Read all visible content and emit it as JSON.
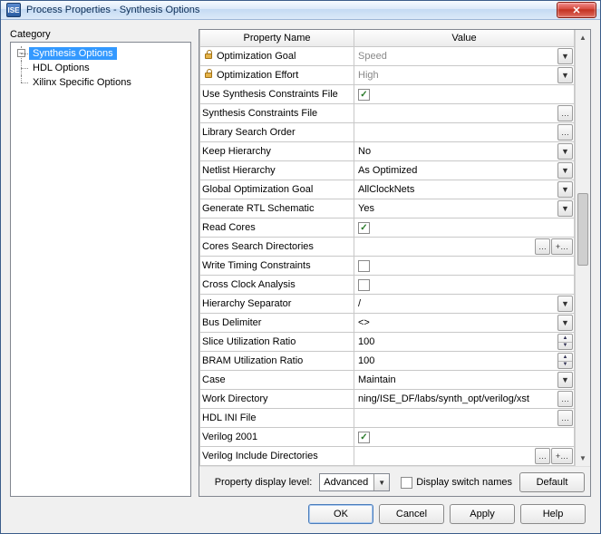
{
  "window": {
    "title": "Process Properties - Synthesis Options",
    "app_icon_text": "ISE"
  },
  "category": {
    "label": "Category",
    "items": [
      {
        "label": "Synthesis Options",
        "selected": true
      },
      {
        "label": "HDL Options",
        "selected": false
      },
      {
        "label": "Xilinx Specific Options",
        "selected": false
      }
    ]
  },
  "grid": {
    "headers": {
      "name": "Property Name",
      "value": "Value"
    },
    "rows": [
      {
        "name": "Optimization Goal",
        "locked": true,
        "type": "dropdown",
        "value": "Speed",
        "disabled": true
      },
      {
        "name": "Optimization Effort",
        "locked": true,
        "type": "dropdown",
        "value": "High",
        "disabled": true
      },
      {
        "name": "Use Synthesis Constraints File",
        "type": "checkbox",
        "value": true
      },
      {
        "name": "Synthesis Constraints File",
        "type": "browse",
        "value": ""
      },
      {
        "name": "Library Search Order",
        "type": "browse",
        "value": ""
      },
      {
        "name": "Keep Hierarchy",
        "type": "dropdown",
        "value": "No"
      },
      {
        "name": "Netlist Hierarchy",
        "type": "dropdown",
        "value": "As Optimized"
      },
      {
        "name": "Global Optimization Goal",
        "type": "dropdown",
        "value": "AllClockNets"
      },
      {
        "name": "Generate RTL Schematic",
        "type": "dropdown",
        "value": "Yes"
      },
      {
        "name": "Read Cores",
        "type": "checkbox",
        "value": true
      },
      {
        "name": "Cores Search Directories",
        "type": "browse_add",
        "value": ""
      },
      {
        "name": "Write Timing Constraints",
        "type": "checkbox",
        "value": false
      },
      {
        "name": "Cross Clock Analysis",
        "type": "checkbox",
        "value": false
      },
      {
        "name": "Hierarchy Separator",
        "type": "dropdown",
        "value": "/"
      },
      {
        "name": "Bus Delimiter",
        "type": "dropdown",
        "value": "<>"
      },
      {
        "name": "Slice Utilization Ratio",
        "type": "spinner",
        "value": "100"
      },
      {
        "name": "BRAM Utilization Ratio",
        "type": "spinner",
        "value": "100"
      },
      {
        "name": "Case",
        "type": "dropdown",
        "value": "Maintain"
      },
      {
        "name": "Work Directory",
        "type": "browse",
        "value": "ning/ISE_DF/labs/synth_opt/verilog/xst"
      },
      {
        "name": "HDL INI File",
        "type": "browse",
        "value": ""
      },
      {
        "name": "Verilog 2001",
        "type": "checkbox",
        "value": true
      },
      {
        "name": "Verilog Include Directories",
        "type": "browse_add",
        "value": ""
      }
    ]
  },
  "footer": {
    "display_level_label": "Property display level:",
    "display_level_value": "Advanced",
    "switch_names_label": "Display switch names",
    "switch_names_checked": false,
    "default_btn": "Default"
  },
  "buttons": {
    "ok": "OK",
    "cancel": "Cancel",
    "apply": "Apply",
    "help": "Help"
  }
}
